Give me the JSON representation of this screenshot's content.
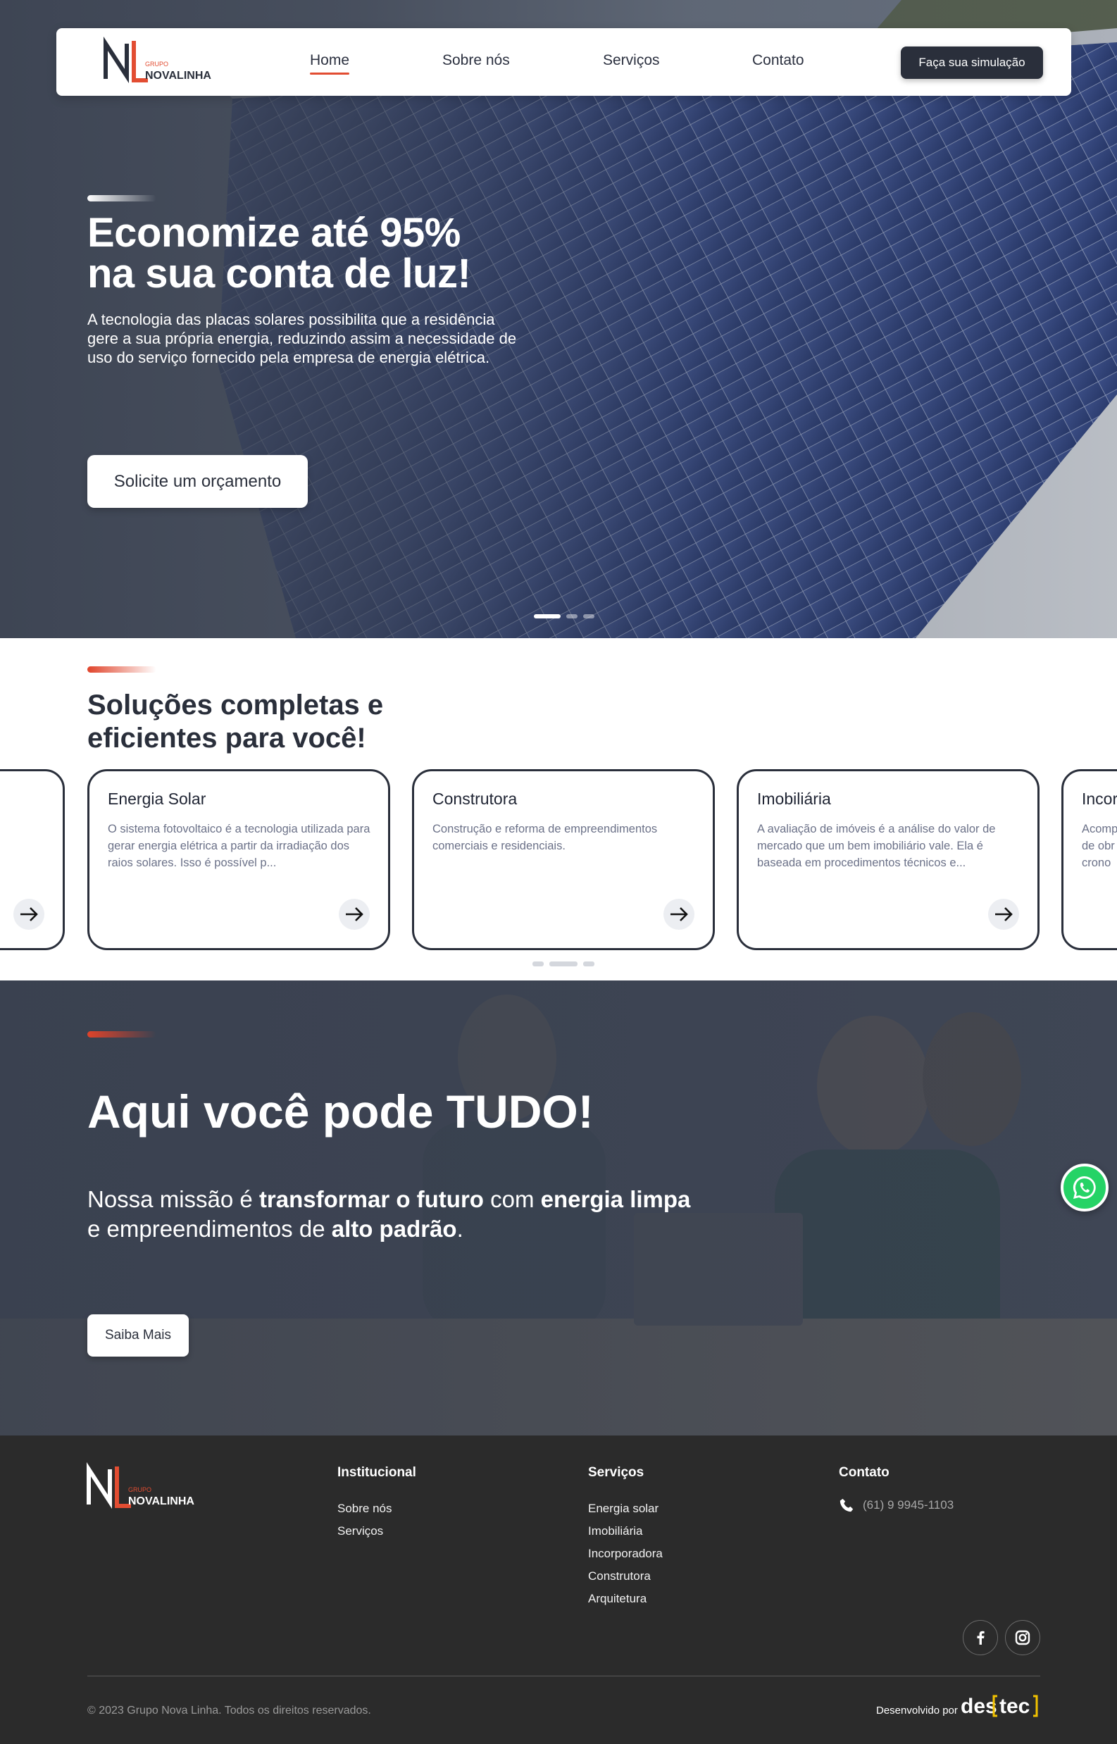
{
  "nav": {
    "logo_small": "GRUPO",
    "logo_name": "NOVALINHA",
    "links": [
      "Home",
      "Sobre nós",
      "Serviços",
      "Contato"
    ],
    "cta": "Faça sua simulação"
  },
  "hero": {
    "title_line1": "Economize até 95%",
    "title_line2": "na sua conta de luz!",
    "text": "A tecnologia das placas solares possibilita que a residência gere a sua própria energia, reduzindo assim a necessidade de uso do serviço fornecido pela empresa de energia elétrica.",
    "button": "Solicite um orçamento"
  },
  "solutions": {
    "heading_part1": "Soluções ",
    "heading_bold1": "completas e eficientes",
    "heading_part2": " para você!",
    "cards": [
      {
        "title": "Energia Solar",
        "text": "O sistema fotovoltaico é a tecnologia utilizada para gerar energia elétrica a partir da irradiação dos raios solares. Isso é possível p..."
      },
      {
        "title": "Construtora",
        "text": "Construção e reforma de empreendimentos comerciais e residenciais."
      },
      {
        "title": "Imobiliária",
        "text": "A avaliação de imóveis é a análise do valor de mercado que um bem imobiliário vale. Ela é baseada em procedimentos técnicos e..."
      },
      {
        "title": "Incor",
        "text": "Acomp de obr crono"
      }
    ]
  },
  "mission": {
    "title_bold1": "Aqui",
    "title_mid": " você pode ",
    "title_bold2": "TUDO!",
    "text_1": "Nossa missão é ",
    "text_b1": "transformar o futuro",
    "text_2": " com ",
    "text_b2": "energia limpa",
    "text_3": " e empreendimentos de ",
    "text_b3": "alto padrão",
    "text_4": ".",
    "button": "Saiba Mais"
  },
  "footer": {
    "logo_small": "GRUPO",
    "logo_name": "NOVALINHA",
    "institucional": {
      "heading": "Institucional",
      "links": [
        "Sobre nós",
        "Serviços"
      ]
    },
    "servicos": {
      "heading": "Serviços",
      "links": [
        "Energia solar",
        "Imobiliária",
        "Incorporadora",
        "Construtora",
        "Arquitetura"
      ]
    },
    "contato": {
      "heading": "Contato",
      "phone": "(61) 9 9945-1103"
    },
    "copyright": "© 2023 Grupo Nova Linha. Todos os direitos reservados.",
    "developed_by": "Desenvolvido por",
    "dev_logo_a": "des",
    "dev_logo_b": "tec"
  },
  "colors": {
    "accent": "#e24d32",
    "dark": "#2a2f3b",
    "footer_bg": "#2b2b2b",
    "whatsapp": "#25d366"
  }
}
